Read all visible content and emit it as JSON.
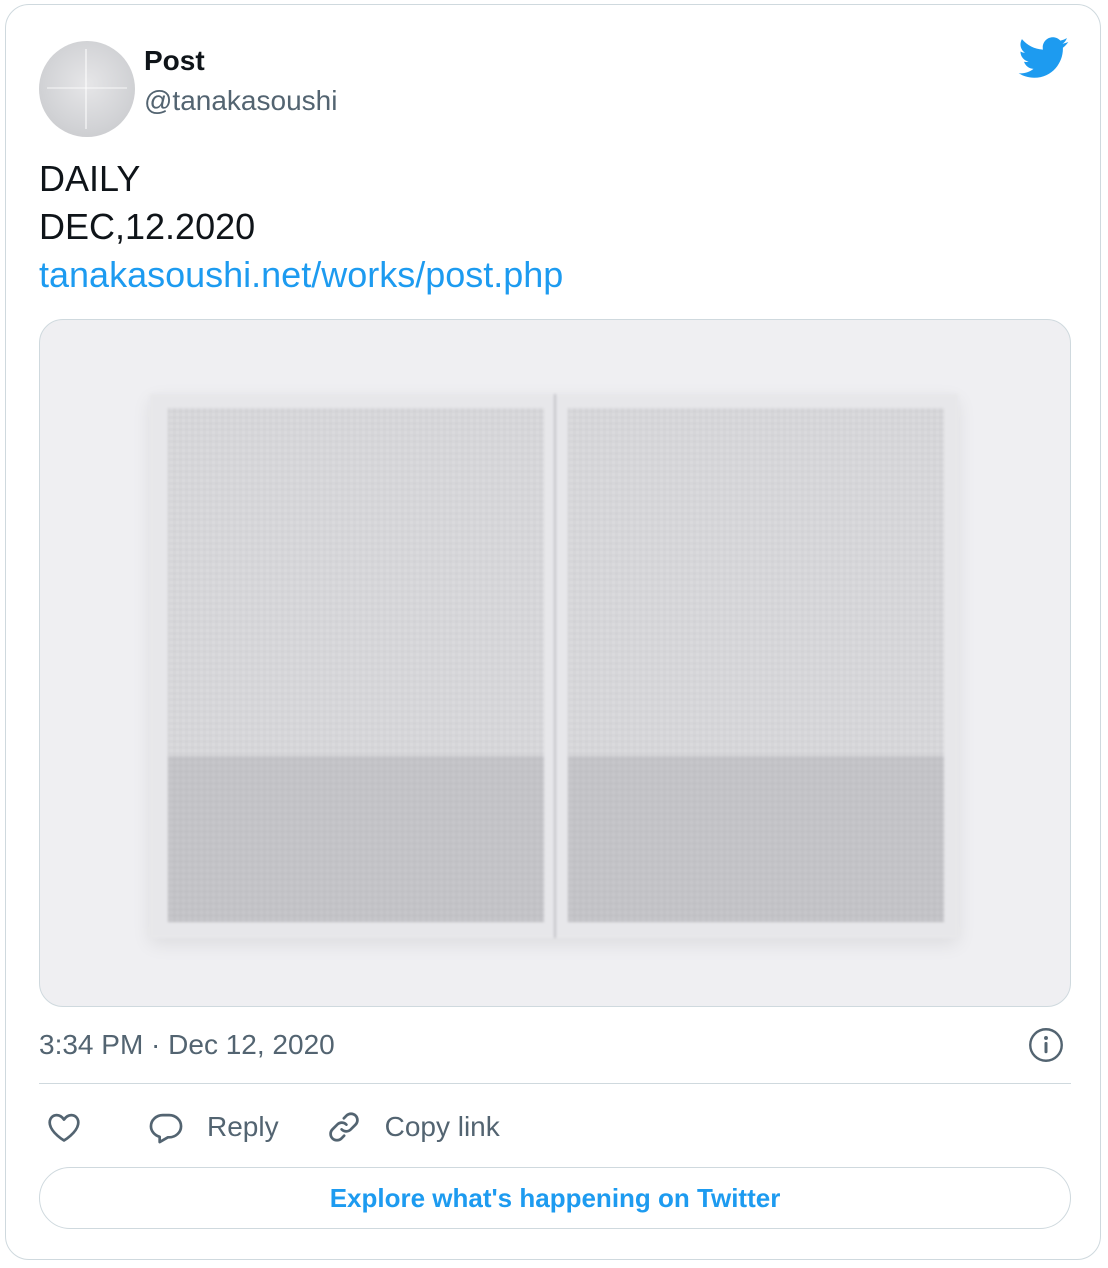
{
  "author": {
    "name": "Post",
    "handle": "@tanakasoushi"
  },
  "brand_icon": "twitter-bird-icon",
  "tweet": {
    "lines": [
      "DAILY",
      "DEC,12.2020"
    ],
    "link": "tanakasoushi.net/works/post.php"
  },
  "media": {
    "image": "blurred-newspaper-photo"
  },
  "meta": {
    "timestamp": "3:34 PM · Dec 12, 2020",
    "info_icon": "info-icon"
  },
  "actions": {
    "like_icon": "heart-icon",
    "reply_label": "Reply",
    "reply_icon": "speech-bubble-icon",
    "copy_label": "Copy link",
    "copy_icon": "link-icon"
  },
  "explore_label": "Explore what's happening on Twitter",
  "colors": {
    "accent": "#1d9bf0",
    "text": "#0f1419",
    "secondary_text": "#536471",
    "border": "#cfd9de"
  }
}
